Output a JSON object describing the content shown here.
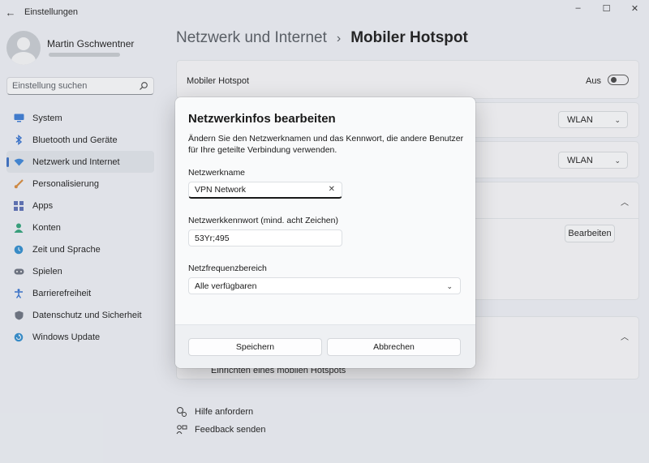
{
  "window": {
    "title": "Einstellungen",
    "back_icon": "←",
    "minimize_icon": "–",
    "maximize_icon": "☐",
    "close_icon": "✕"
  },
  "profile": {
    "name": "Martin Gschwentner"
  },
  "search": {
    "placeholder": "Einstellung suchen"
  },
  "sidebar": {
    "items": [
      {
        "label": "System",
        "icon": "monitor-icon",
        "color": "#3a7bd5"
      },
      {
        "label": "Bluetooth und Geräte",
        "icon": "bluetooth-icon",
        "color": "#2f6fd0"
      },
      {
        "label": "Netzwerk und Internet",
        "icon": "wifi-icon",
        "color": "#3b86d9",
        "active": true
      },
      {
        "label": "Personalisierung",
        "icon": "brush-icon",
        "color": "#d98a3b"
      },
      {
        "label": "Apps",
        "icon": "apps-icon",
        "color": "#5a6fb5"
      },
      {
        "label": "Konten",
        "icon": "account-icon",
        "color": "#2fa37a"
      },
      {
        "label": "Zeit und Sprache",
        "icon": "globe-clock-icon",
        "color": "#2f8ed0"
      },
      {
        "label": "Spielen",
        "icon": "gamepad-icon",
        "color": "#6b7280"
      },
      {
        "label": "Barrierefreiheit",
        "icon": "accessibility-icon",
        "color": "#2f6fd0"
      },
      {
        "label": "Datenschutz und Sicherheit",
        "icon": "shield-icon",
        "color": "#6b7280"
      },
      {
        "label": "Windows Update",
        "icon": "update-icon",
        "color": "#2f8ed0"
      }
    ]
  },
  "breadcrumb": {
    "parent": "Netzwerk und Internet",
    "separator": "›",
    "current": "Mobiler Hotspot"
  },
  "main": {
    "hotspot_label": "Mobiler Hotspot",
    "hotspot_state": "Aus",
    "share_from_value": "WLAN",
    "share_over_value": "WLAN",
    "edit_button": "Bearbeiten",
    "setup_link": "Einrichten eines mobilen Hotspots",
    "help_link": "Hilfe anfordern",
    "feedback_link": "Feedback senden"
  },
  "dialog": {
    "title": "Netzwerkinfos bearbeiten",
    "description": "Ändern Sie den Netzwerknamen und das Kennwort, die andere Benutzer für Ihre geteilte Verbindung verwenden.",
    "network_name_label": "Netzwerkname",
    "network_name_value": "VPN Network",
    "password_label": "Netzwerkkennwort (mind. acht Zeichen)",
    "password_value": "53Yr;495",
    "band_label": "Netzfrequenzbereich",
    "band_value": "Alle verfügbaren",
    "save_button": "Speichern",
    "cancel_button": "Abbrechen"
  }
}
